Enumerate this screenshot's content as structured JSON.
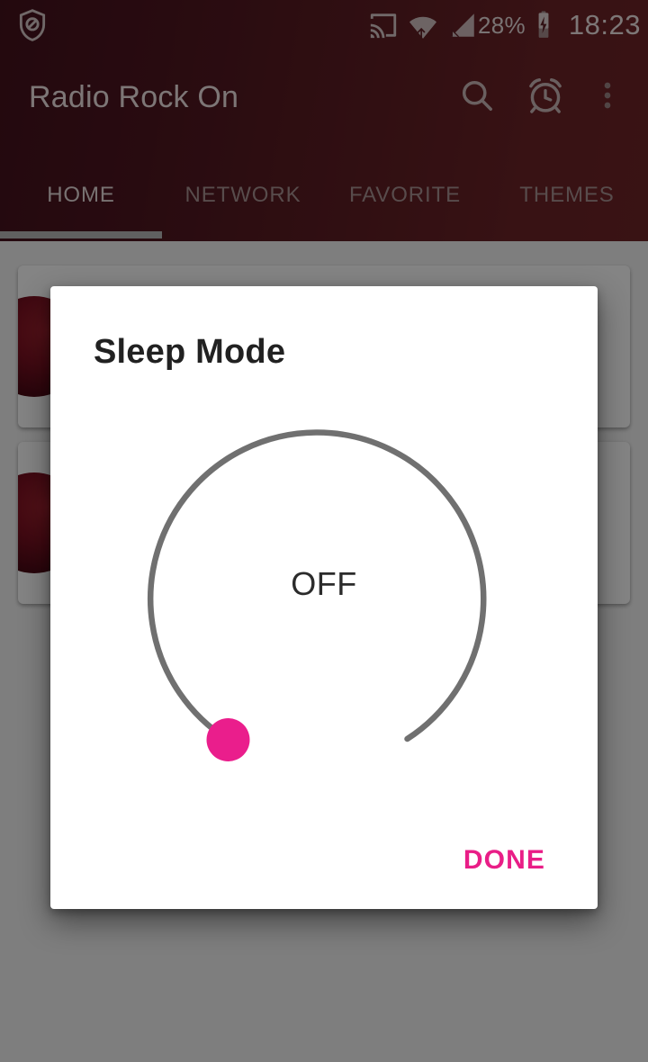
{
  "status_bar": {
    "shield_icon": "shield-block-icon",
    "cast_icon": "cast-icon",
    "wifi_icon": "wifi-transfer-icon",
    "signal_icon": "cellular-signal-icon",
    "battery_text": "28%",
    "battery_icon": "battery-charging-icon",
    "time": "18:23"
  },
  "toolbar": {
    "title": "Radio Rock On",
    "search_icon": "search-icon",
    "alarm_icon": "alarm-clock-icon",
    "overflow_icon": "overflow-menu-icon"
  },
  "tabs": {
    "items": [
      {
        "label": "HOME",
        "active": true
      },
      {
        "label": "NETWORK",
        "active": false
      },
      {
        "label": "FAVORITE",
        "active": false
      },
      {
        "label": "THEMES",
        "active": false
      }
    ]
  },
  "dialog": {
    "title": "Sleep Mode",
    "dial": {
      "value_text": "OFF",
      "thumb_color": "#ea1e8c",
      "track_color": "#707070",
      "progress": 0
    },
    "done_label": "DONE"
  },
  "colors": {
    "appbar_start": "#44121c",
    "appbar_end": "#6e2528",
    "accent": "#e91e87",
    "scrim": "rgba(0,0,0,0.48)"
  }
}
